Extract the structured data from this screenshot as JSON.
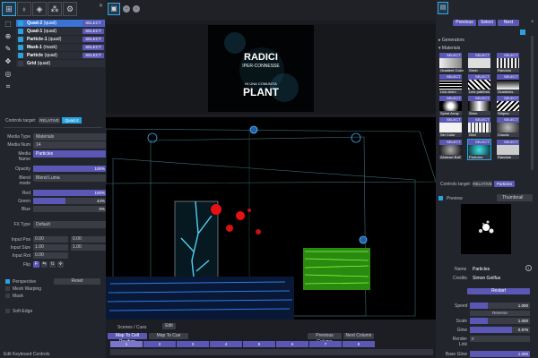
{
  "layers": [
    {
      "name": "Quad-2",
      "type": "(quad)",
      "selected": true,
      "checked": true,
      "select": "SELECT"
    },
    {
      "name": "Quad-1",
      "type": "(quad)",
      "selected": false,
      "checked": true,
      "select": "SELECT"
    },
    {
      "name": "Particle-1",
      "type": "(quad)",
      "selected": false,
      "checked": true,
      "select": "SELECT"
    },
    {
      "name": "Mask-1",
      "type": "(mask)",
      "selected": false,
      "checked": true,
      "select": "SELECT"
    },
    {
      "name": "Particle",
      "type": "(quad)",
      "selected": false,
      "checked": true,
      "select": "SELECT"
    },
    {
      "name": "Grid",
      "type": "(quad)",
      "selected": false,
      "checked": false,
      "select": ""
    }
  ],
  "controls": {
    "label": "Controls target:",
    "relative": "RELATIVE",
    "target": "Quad-2",
    "media_type_label": "Media Type",
    "media_type": "Materials",
    "media_num_label": "Media Num",
    "media_num": "14",
    "media_name_label": "Media Name",
    "media_name": "Particles",
    "opacity_label": "Opacity",
    "opacity": "100%",
    "opacity_frac": 1.0,
    "blend_label": "Blend mode",
    "blend": "Blend Luma",
    "red_label": "Red",
    "red": "100%",
    "red_frac": 1.0,
    "green_label": "Green",
    "green": "44%",
    "green_frac": 0.44,
    "blue_label": "Blue",
    "blue": "0%",
    "blue_frac": 0.0,
    "fx_label": "FX Type",
    "fx": "Default",
    "input_pos_label": "Input Pos",
    "input_pos_x": "0.00",
    "input_pos_y": "0.00",
    "input_size_label": "Input Size",
    "input_size_x": "1.00",
    "input_size_y": "1.00",
    "input_rot_label": "Input Rot",
    "input_rot": "0.00",
    "flip_label": "Flip",
    "perspective": "Perspective",
    "reset": "Reset",
    "mesh_warping": "Mesh Warping",
    "mask": "Mask",
    "soft_edge": "Soft-Edge"
  },
  "status": "Edit Keyboard Controls",
  "preview_text": {
    "line1": "RADICI",
    "line2": "IPER-CONNESSE",
    "line3": "IN UNA COMUNITA",
    "line4": "PLANT"
  },
  "scenes": {
    "title": "Scenes / Cues",
    "edit": "Edit",
    "map_to_cell": "Map To Cell Position",
    "map_to_cue": "Map To Cue",
    "prev_column": "Previous Column",
    "next_column": "Next Column",
    "columns": [
      "1",
      "2",
      "3",
      "4",
      "5",
      "6",
      "7",
      "8"
    ]
  },
  "right": {
    "previous": "Previous",
    "select": "Select",
    "next": "Next",
    "generators": "Generators",
    "materials": "Materials",
    "tiles": [
      {
        "name": "Gradient Color",
        "select": "SELECT"
      },
      {
        "name": "Strob",
        "select": "SELECT"
      },
      {
        "name": "Random",
        "select": "SELECT"
      },
      {
        "name": "Line Anim",
        "select": "SELECT"
      },
      {
        "name": "Line patterns",
        "select": "SELECT"
      },
      {
        "name": "Gradients",
        "select": "SELECT"
      },
      {
        "name": "Spiral Array",
        "select": "SELECT"
      },
      {
        "name": "Siren",
        "select": "SELECT"
      },
      {
        "name": "Stripes",
        "select": "SELECT"
      },
      {
        "name": "Sel Color",
        "select": "SELECT"
      },
      {
        "name": "Grid",
        "select": "SELECT"
      },
      {
        "name": "Clouds",
        "select": "SELECT"
      },
      {
        "name": "Abstract Ball",
        "select": "SELECT"
      },
      {
        "name": "Particles",
        "select": "SELECT"
      },
      {
        "name": "Random",
        "select": "SELECT"
      }
    ],
    "controls_label": "Controls target:",
    "relative": "RELATIVE",
    "target": "Particles",
    "preview": "Preview",
    "thumbnail": "Thumbnail",
    "name_label": "Name",
    "name": "Particles",
    "credits_label": "Credits",
    "credits": "Simon Geilfus",
    "restart": "Restart",
    "speed_label": "Speed",
    "speed": "1.000",
    "speed_frac": 0.3,
    "reverse": "Reverse",
    "scale_label": "Scale",
    "scale": "1.000",
    "scale_frac": 0.3,
    "glow_label": "Glow",
    "glow": "0.976",
    "glow_frac": 0.7,
    "render_link_label": "Render Link",
    "render_link": "0",
    "base_glow_label": "Base Glow",
    "base_glow": "1.000"
  },
  "colors": {
    "accent": "#5b57b5",
    "blue": "#3b72d6",
    "cyan": "#29a3e0"
  }
}
